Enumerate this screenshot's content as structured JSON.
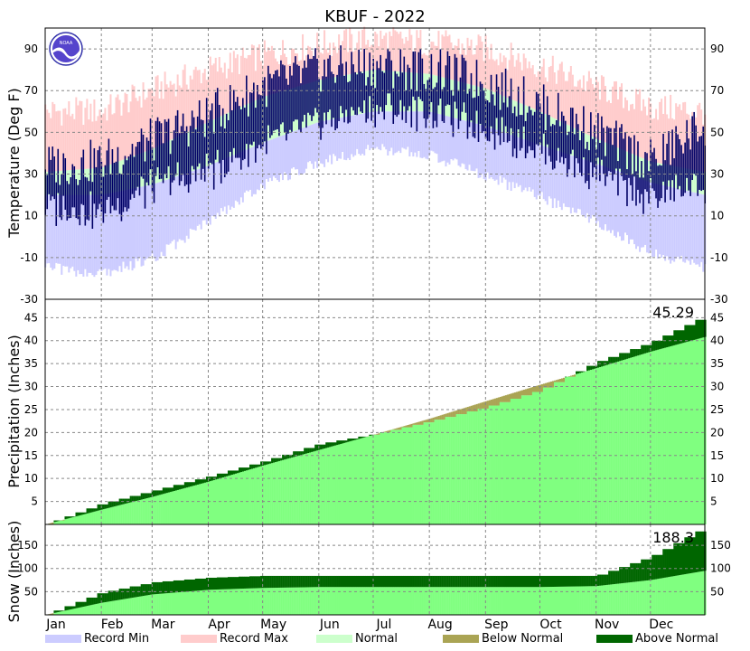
{
  "title": "KBUF - 2022",
  "colors": {
    "record_min": "#ccccff",
    "record_max": "#ffcccc",
    "normal": "#ccffcc",
    "observed_temp": "#000066",
    "normal_accum": "#80ff80",
    "below_normal": "#aaa454",
    "above_normal": "#006600",
    "grid": "#888888",
    "frame": "#000000"
  },
  "months": [
    "Jan",
    "Feb",
    "Mar",
    "Apr",
    "May",
    "Jun",
    "Jul",
    "Aug",
    "Sep",
    "Oct",
    "Nov",
    "Dec"
  ],
  "legend": [
    {
      "label": "Record Min",
      "color": "#ccccff"
    },
    {
      "label": "Record Max",
      "color": "#ffcccc"
    },
    {
      "label": "Normal",
      "color": "#ccffcc"
    },
    {
      "label": "Below Normal",
      "color": "#aaa454"
    },
    {
      "label": "Above Normal",
      "color": "#006600"
    }
  ],
  "chart_data": [
    {
      "type": "area",
      "panel": "temperature",
      "ylabel": "Temperature (Deg F)",
      "ylim": [
        -30,
        100
      ],
      "yticks": [
        -30,
        -10,
        10,
        30,
        50,
        70,
        90
      ],
      "x_unit": "day_of_year",
      "grid": true,
      "series": [
        {
          "name": "Record Max",
          "kind": "band_top",
          "x": [
            1,
            32,
            60,
            91,
            121,
            152,
            182,
            213,
            244,
            274,
            305,
            335,
            365
          ],
          "values": [
            60,
            60,
            70,
            80,
            87,
            92,
            95,
            93,
            90,
            82,
            72,
            62,
            60
          ]
        },
        {
          "name": "Normal",
          "kind": "band",
          "x": [
            1,
            32,
            60,
            91,
            121,
            152,
            182,
            213,
            244,
            274,
            305,
            335,
            365
          ],
          "low": [
            20,
            20,
            25,
            34,
            45,
            55,
            60,
            60,
            53,
            44,
            35,
            26,
            20
          ],
          "high": [
            31,
            33,
            42,
            55,
            67,
            75,
            80,
            78,
            71,
            60,
            47,
            36,
            31
          ]
        },
        {
          "name": "Record Min",
          "kind": "band_bottom",
          "x": [
            1,
            32,
            60,
            91,
            121,
            152,
            182,
            213,
            244,
            274,
            305,
            335,
            365
          ],
          "values": [
            -12,
            -15,
            -8,
            10,
            28,
            38,
            45,
            42,
            32,
            22,
            10,
            -5,
            -12
          ]
        },
        {
          "name": "Observed",
          "kind": "daily_range_bars",
          "x": [
            1,
            32,
            60,
            91,
            121,
            152,
            182,
            213,
            244,
            274,
            305,
            335,
            365
          ],
          "low": [
            14,
            12,
            24,
            31,
            44,
            54,
            61,
            60,
            52,
            42,
            30,
            18,
            26
          ],
          "high": [
            34,
            36,
            46,
            58,
            72,
            80,
            82,
            80,
            74,
            63,
            50,
            36,
            54
          ]
        }
      ]
    },
    {
      "type": "area",
      "panel": "precipitation",
      "ylabel": "Precipitation (Inches)",
      "ylim": [
        0,
        49
      ],
      "yticks": [
        5,
        10,
        15,
        20,
        25,
        30,
        35,
        40,
        45
      ],
      "annotation": "45.29",
      "grid": true,
      "series": [
        {
          "name": "Normal",
          "x": [
            1,
            32,
            60,
            91,
            121,
            152,
            182,
            213,
            244,
            274,
            305,
            335,
            365
          ],
          "values": [
            0,
            3.2,
            6.0,
            9.3,
            12.8,
            16.2,
            19.5,
            23.0,
            26.8,
            30.4,
            34.0,
            37.6,
            40.8
          ]
        },
        {
          "name": "Observed",
          "x": [
            1,
            32,
            60,
            91,
            121,
            152,
            182,
            213,
            244,
            274,
            305,
            335,
            365
          ],
          "values": [
            0,
            4.5,
            7.3,
            10.4,
            13.7,
            17.5,
            19.6,
            22.4,
            25.5,
            29.2,
            35.3,
            39.6,
            45.29
          ]
        }
      ]
    },
    {
      "type": "area",
      "panel": "snow",
      "ylabel": "Snow (Inches)",
      "ylim": [
        0,
        195
      ],
      "yticks": [
        50,
        100,
        150
      ],
      "annotation": "188.3",
      "grid": true,
      "series": [
        {
          "name": "Normal",
          "x": [
            1,
            32,
            60,
            91,
            121,
            152,
            182,
            213,
            244,
            274,
            305,
            335,
            365
          ],
          "values": [
            0,
            26,
            44,
            54,
            58,
            60,
            60,
            60,
            60,
            60,
            62,
            75,
            95
          ]
        },
        {
          "name": "Observed",
          "x": [
            1,
            32,
            60,
            91,
            121,
            152,
            182,
            213,
            244,
            274,
            305,
            335,
            365
          ],
          "values": [
            0,
            48,
            70,
            80,
            84,
            84,
            84,
            84,
            84,
            84,
            84,
            125,
            188.3
          ]
        }
      ]
    }
  ]
}
